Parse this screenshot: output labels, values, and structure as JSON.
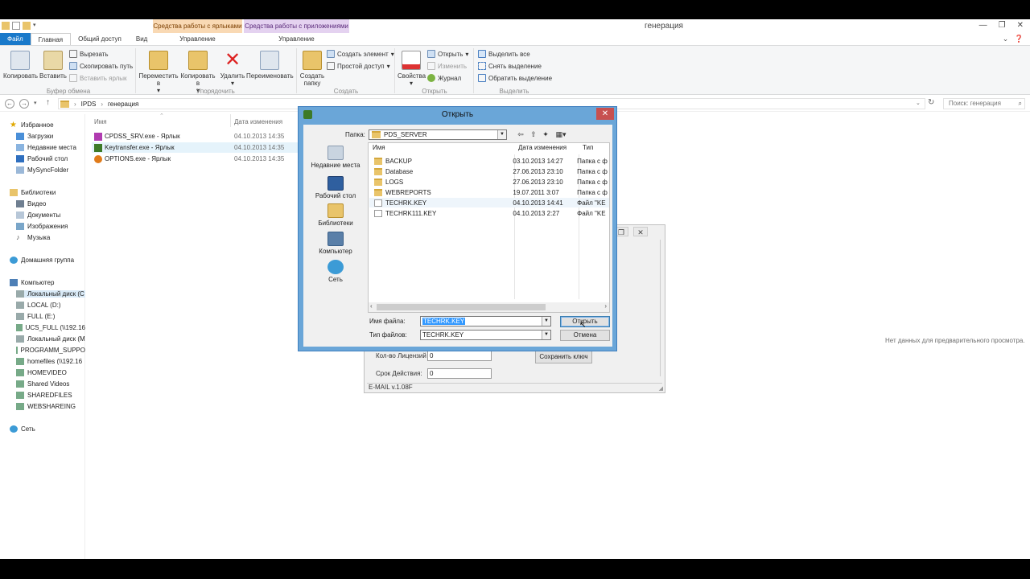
{
  "window": {
    "title": "генерация",
    "context_tabs": {
      "shortcut_tools": "Средства работы с ярлыками",
      "app_tools": "Средства работы с приложениями"
    }
  },
  "ribbon_tabs": [
    "Файл",
    "Главная",
    "Общий доступ",
    "Вид"
  ],
  "context_subtabs": [
    "Управление",
    "Управление"
  ],
  "ribbon": {
    "clipboard": {
      "copy": "Копировать",
      "paste": "Вставить",
      "cut": "Вырезать",
      "copy_path": "Скопировать путь",
      "paste_shortcut": "Вставить ярлык",
      "group": "Буфер обмена"
    },
    "organize": {
      "move": "Переместить в",
      "copy_to": "Копировать в",
      "delete": "Удалить",
      "rename": "Переименовать",
      "group": "Упорядочить"
    },
    "create": {
      "new_folder": "Создать папку",
      "new_item": "Создать элемент",
      "easy_access": "Простой доступ",
      "group": "Создать"
    },
    "open": {
      "properties": "Свойства",
      "open": "Открыть",
      "edit": "Изменить",
      "history": "Журнал",
      "group": "Открыть"
    },
    "select": {
      "select_all": "Выделить все",
      "select_none": "Снять выделение",
      "invert": "Обратить выделение",
      "group": "Выделить"
    }
  },
  "address": {
    "crumbs": [
      "IPDS",
      "генерация"
    ],
    "search_placeholder": "Поиск: генерация"
  },
  "nav": {
    "favorites": {
      "label": "Избранное",
      "items": [
        "Загрузки",
        "Недавние места",
        "Рабочий стол",
        "MySyncFolder"
      ]
    },
    "libraries": {
      "label": "Библиотеки",
      "items": [
        "Видео",
        "Документы",
        "Изображения",
        "Музыка"
      ]
    },
    "homegroup": "Домашняя группа",
    "computer": {
      "label": "Компьютер",
      "items": [
        "Локальный диск (C",
        "LOCAL (D:)",
        "FULL (E:)",
        "UCS_FULL (\\\\192.16",
        "Локальный диск (M",
        "PROGRAMM_SUPPO",
        "homefiles (\\\\192.16",
        "HOMEVIDEO",
        "Shared Videos",
        "SHAREDFILES",
        "WEBSHAREING"
      ]
    },
    "network": "Сеть"
  },
  "filelist": {
    "columns": {
      "name": "Имя",
      "date": "Дата изменения"
    },
    "rows": [
      {
        "name": "CPDSS_SRV.exe - Ярлык",
        "date": "04.10.2013 14:35"
      },
      {
        "name": "Keytransfer.exe - Ярлык",
        "date": "04.10.2013 14:35"
      },
      {
        "name": "OPTIONS.exe - Ярлык",
        "date": "04.10.2013 14:35"
      }
    ],
    "preview_text": "Нет данных для предварительного просмотра."
  },
  "bg_app": {
    "licenses_label": "Кол-во Лицензий",
    "licenses_value": "0",
    "term_label": "Срок Действия:",
    "term_value": "0",
    "save_key": "Сохранить ключ",
    "status": "E-MAIL v.1.08F"
  },
  "dialog": {
    "title": "Открыть",
    "folder_label": "Папка:",
    "folder_value": "PDS_SERVER",
    "places": [
      "Недавние места",
      "Рабочий стол",
      "Библиотеки",
      "Компьютер",
      "Сеть"
    ],
    "columns": {
      "name": "Имя",
      "date": "Дата изменения",
      "type": "Тип"
    },
    "rows": [
      {
        "name": "BACKUP",
        "date": "03.10.2013 14:27",
        "type": "Папка с ф",
        "kind": "folder"
      },
      {
        "name": "Database",
        "date": "27.06.2013 23:10",
        "type": "Папка с ф",
        "kind": "folder"
      },
      {
        "name": "LOGS",
        "date": "27.06.2013 23:10",
        "type": "Папка с ф",
        "kind": "folder"
      },
      {
        "name": "WEBREPORTS",
        "date": "19.07.2011 3:07",
        "type": "Папка с ф",
        "kind": "folder"
      },
      {
        "name": "TECHRK.KEY",
        "date": "04.10.2013 14:41",
        "type": "Файл \"KE",
        "kind": "file"
      },
      {
        "name": "TECHRK111.KEY",
        "date": "04.10.2013 2:27",
        "type": "Файл \"KE",
        "kind": "file"
      }
    ],
    "filename_label": "Имя файла:",
    "filename_value": "TECHRK.KEY",
    "filetype_label": "Тип файлов:",
    "filetype_value": "TECHRK.KEY",
    "open_button": "Открыть",
    "cancel_button": "Отмена"
  },
  "colors": {
    "accent": "#1979ca",
    "dialog_frame": "#6aa6d8",
    "close_red": "#c75050",
    "selection": "#3399ff"
  }
}
